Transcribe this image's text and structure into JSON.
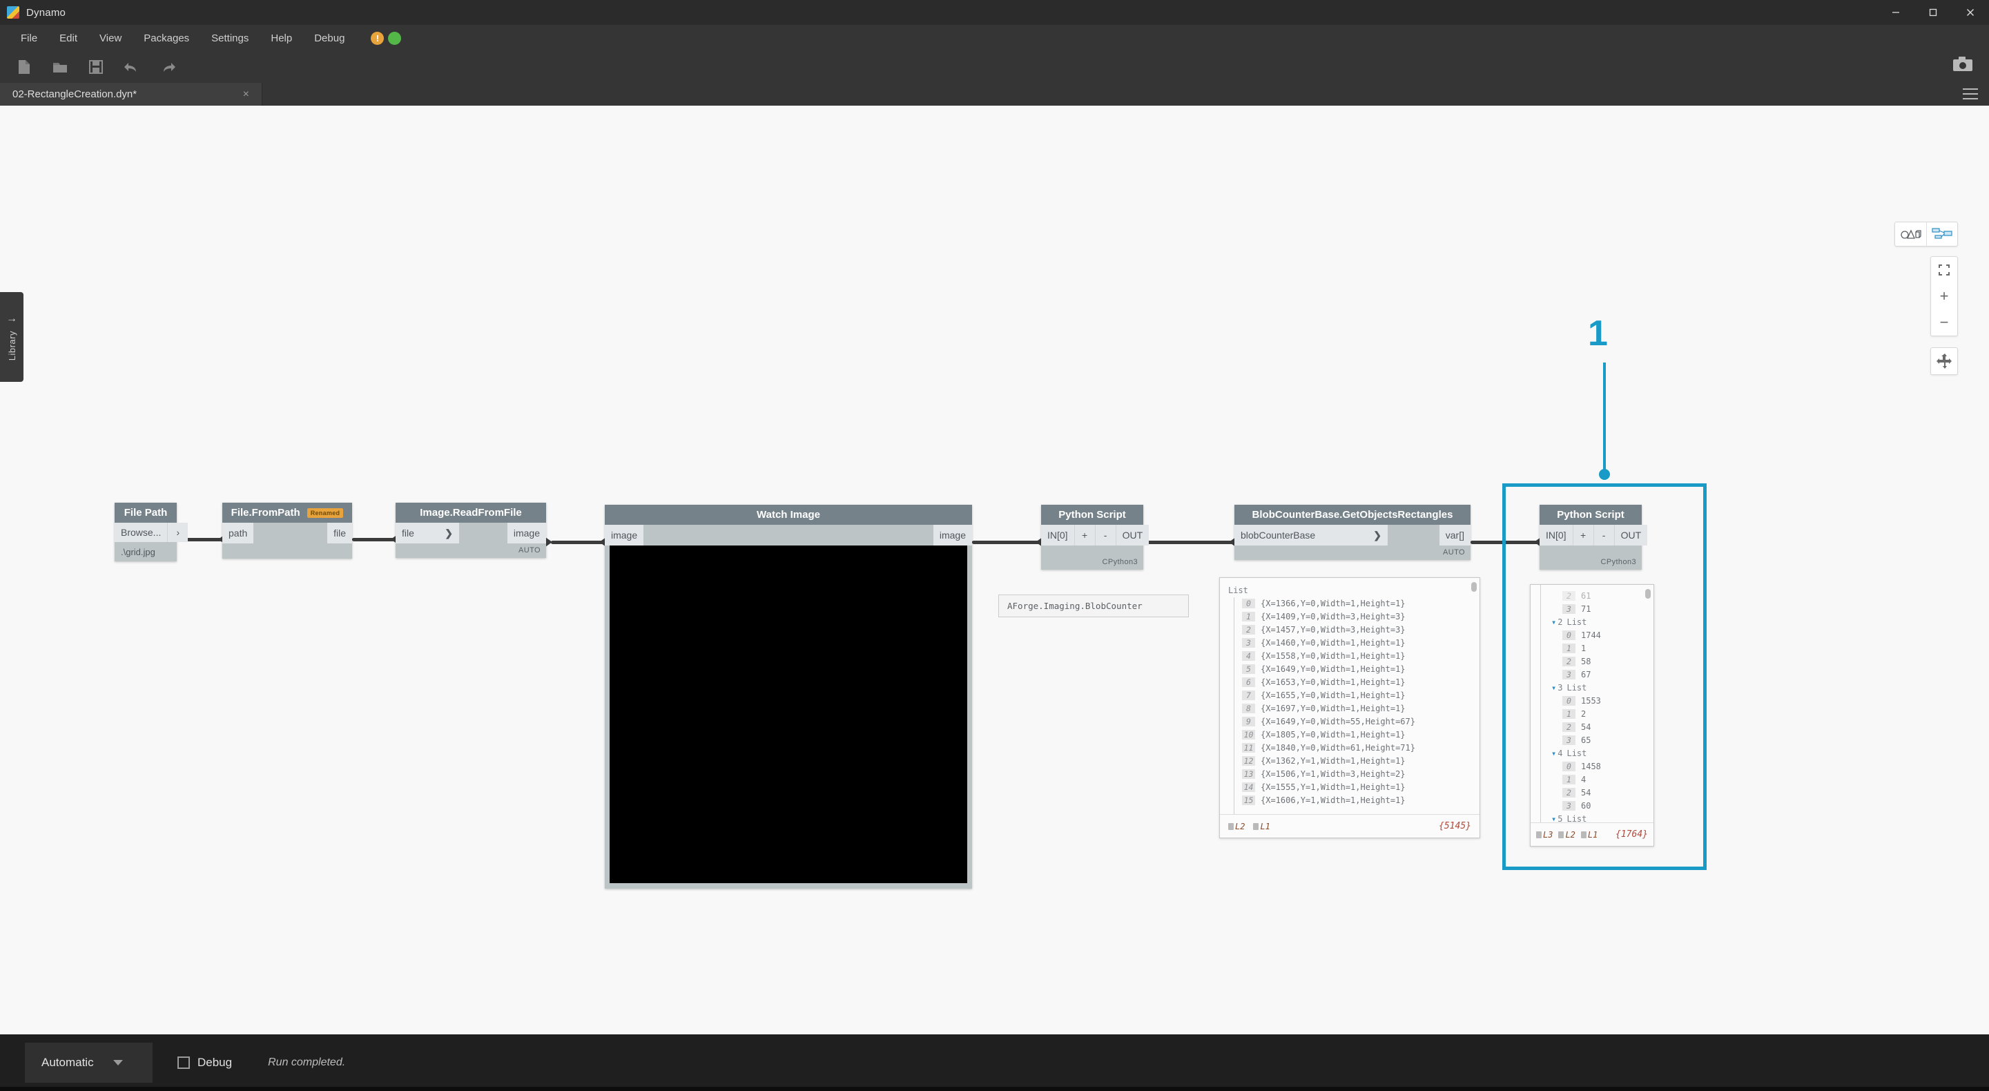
{
  "window": {
    "app_title": "Dynamo",
    "logo_icon": "dynamo-logo-icon",
    "controls": [
      {
        "name": "minimize-button",
        "icon": "minimize-icon"
      },
      {
        "name": "maximize-button",
        "icon": "maximize-icon"
      },
      {
        "name": "close-button",
        "icon": "close-icon"
      }
    ]
  },
  "menubar": {
    "items": [
      {
        "label": "File"
      },
      {
        "label": "Edit"
      },
      {
        "label": "View"
      },
      {
        "label": "Packages"
      },
      {
        "label": "Settings"
      },
      {
        "label": "Help"
      },
      {
        "label": "Debug"
      }
    ],
    "notifications": [
      {
        "name": "warning-notification",
        "glyph": "!",
        "color": "#e8a33d"
      },
      {
        "name": "ok-notification",
        "glyph": "",
        "color": "#53b848"
      }
    ]
  },
  "toolbar": {
    "buttons": [
      {
        "name": "new-file-button",
        "icon": "new-file-icon"
      },
      {
        "name": "open-file-button",
        "icon": "folder-open-icon"
      },
      {
        "name": "save-file-button",
        "icon": "save-disk-icon"
      },
      {
        "name": "undo-button",
        "icon": "undo-arrow-icon"
      },
      {
        "name": "redo-button",
        "icon": "redo-arrow-icon"
      }
    ],
    "camera_button": {
      "name": "screenshot-button",
      "icon": "camera-icon"
    }
  },
  "tab": {
    "label": "02-RectangleCreation.dyn*",
    "close_glyph": "×",
    "menu_icon": "hamburger-icon"
  },
  "library": {
    "label": "Library",
    "arrow_glyph": "→"
  },
  "canvas_controls": {
    "view_toggle": [
      {
        "name": "geometry-view-button",
        "icon": "geometry-shapes-icon"
      },
      {
        "name": "graph-view-button",
        "icon": "graph-nodes-icon"
      }
    ],
    "zoom": [
      {
        "name": "zoom-to-fit-button",
        "icon": "fit-corners-icon",
        "glyph": ""
      },
      {
        "name": "zoom-in-button",
        "icon": "plus-icon",
        "glyph": "+"
      },
      {
        "name": "zoom-out-button",
        "icon": "minus-icon",
        "glyph": "−"
      }
    ],
    "pan": {
      "name": "pan-button",
      "icon": "pan-move-icon"
    }
  },
  "annotation": {
    "number": "1"
  },
  "nodes": [
    {
      "id": "file-path",
      "title": "File Path",
      "browse_label": "Browse...",
      "chevron": "›",
      "value": ".\\grid.jpg"
    },
    {
      "id": "file-frompath",
      "title": "File.FromPath",
      "badge": "Renamed",
      "input": "path",
      "output": "file"
    },
    {
      "id": "image-readfromfile",
      "title": "Image.ReadFromFile",
      "input": "file",
      "chevron": "❯",
      "output": "image",
      "footer": "AUTO"
    },
    {
      "id": "watch-image",
      "title": "Watch Image",
      "input": "image",
      "output": "image"
    },
    {
      "id": "python-script-1",
      "title": "Python Script",
      "input": "IN[0]",
      "plus": "+",
      "minus": "-",
      "output": "OUT",
      "footer": "CPython3",
      "tooltip": "AForge.Imaging.BlobCounter"
    },
    {
      "id": "blobcounter",
      "title": "BlobCounterBase.GetObjectsRectangles",
      "input": "blobCounterBase",
      "chevron": "❯",
      "output": "var[]",
      "footer": "AUTO"
    },
    {
      "id": "python-script-2",
      "title": "Python Script",
      "input": "IN[0]",
      "plus": "+",
      "minus": "-",
      "output": "OUT",
      "footer": "CPython3"
    }
  ],
  "preview_rectangles": {
    "root_label": "List",
    "rows": [
      {
        "index": "0",
        "value": "{X=1366,Y=0,Width=1,Height=1}"
      },
      {
        "index": "1",
        "value": "{X=1409,Y=0,Width=3,Height=3}"
      },
      {
        "index": "2",
        "value": "{X=1457,Y=0,Width=3,Height=3}"
      },
      {
        "index": "3",
        "value": "{X=1460,Y=0,Width=1,Height=1}"
      },
      {
        "index": "4",
        "value": "{X=1558,Y=0,Width=1,Height=1}"
      },
      {
        "index": "5",
        "value": "{X=1649,Y=0,Width=1,Height=1}"
      },
      {
        "index": "6",
        "value": "{X=1653,Y=0,Width=1,Height=1}"
      },
      {
        "index": "7",
        "value": "{X=1655,Y=0,Width=1,Height=1}"
      },
      {
        "index": "8",
        "value": "{X=1697,Y=0,Width=1,Height=1}"
      },
      {
        "index": "9",
        "value": "{X=1649,Y=0,Width=55,Height=67}"
      },
      {
        "index": "10",
        "value": "{X=1805,Y=0,Width=1,Height=1}"
      },
      {
        "index": "11",
        "value": "{X=1840,Y=0,Width=61,Height=71}"
      },
      {
        "index": "12",
        "value": "{X=1362,Y=1,Width=1,Height=1}"
      },
      {
        "index": "13",
        "value": "{X=1506,Y=1,Width=3,Height=2}"
      },
      {
        "index": "14",
        "value": "{X=1555,Y=1,Width=1,Height=1}"
      },
      {
        "index": "15",
        "value": "{X=1606,Y=1,Width=1,Height=1}"
      }
    ],
    "levels": [
      "L2",
      "L1"
    ],
    "count": "{5145}"
  },
  "preview_lists": {
    "rows": [
      {
        "kind": "leaf",
        "index": "2",
        "value": "61",
        "partial": true
      },
      {
        "kind": "leaf",
        "index": "3",
        "value": "71"
      },
      {
        "kind": "group",
        "index": "2",
        "value": "List"
      },
      {
        "kind": "leaf",
        "index": "0",
        "value": "1744"
      },
      {
        "kind": "leaf",
        "index": "1",
        "value": "1"
      },
      {
        "kind": "leaf",
        "index": "2",
        "value": "58"
      },
      {
        "kind": "leaf",
        "index": "3",
        "value": "67"
      },
      {
        "kind": "group",
        "index": "3",
        "value": "List"
      },
      {
        "kind": "leaf",
        "index": "0",
        "value": "1553"
      },
      {
        "kind": "leaf",
        "index": "1",
        "value": "2"
      },
      {
        "kind": "leaf",
        "index": "2",
        "value": "54"
      },
      {
        "kind": "leaf",
        "index": "3",
        "value": "65"
      },
      {
        "kind": "group",
        "index": "4",
        "value": "List"
      },
      {
        "kind": "leaf",
        "index": "0",
        "value": "1458"
      },
      {
        "kind": "leaf",
        "index": "1",
        "value": "4"
      },
      {
        "kind": "leaf",
        "index": "2",
        "value": "54"
      },
      {
        "kind": "leaf",
        "index": "3",
        "value": "60"
      },
      {
        "kind": "group",
        "index": "5",
        "value": "List"
      }
    ],
    "levels": [
      "L3",
      "L2",
      "L1"
    ],
    "count": "{1764}"
  },
  "statusbar": {
    "run_mode": "Automatic",
    "debug_label": "Debug",
    "run_status": "Run completed."
  },
  "colors": {
    "accent": "#1a9bc7",
    "node_header": "#75828a",
    "node_body": "#bcc4c6",
    "chrome_dark": "#2b2b2b",
    "chrome_mid": "#353535",
    "badge": "#e8a33d",
    "count_text": "#b04a3a"
  }
}
